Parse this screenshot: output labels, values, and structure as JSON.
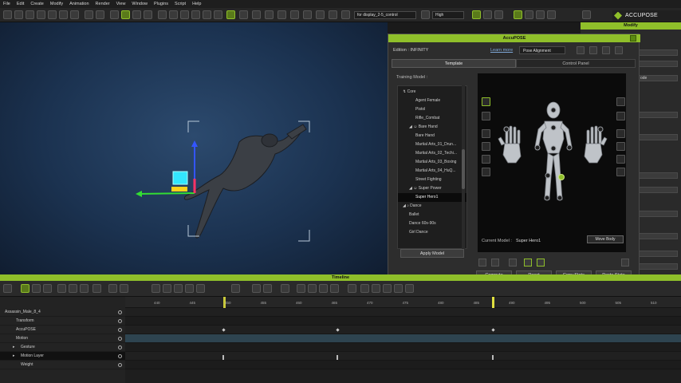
{
  "menu": [
    "File",
    "Edit",
    "Create",
    "Modify",
    "Animation",
    "Render",
    "View",
    "Window",
    "Plugins",
    "Script",
    "Help"
  ],
  "toolbar": {
    "display_select": "for display_2-5_control",
    "quality_select": "High",
    "brand": "ACCUPOSE"
  },
  "modify_panel": {
    "title": "Modify",
    "mode_text": "ode"
  },
  "accupose": {
    "title": "AccuPOSE",
    "edition_label": "Edition : INFINITY",
    "learn_more": "Learn more",
    "pose_alignment": "Pose Alignment",
    "tabs": [
      "Template",
      "Control Panel"
    ],
    "training_model_label": "Training Model :",
    "tree": [
      {
        "label": "Core",
        "indent": 0,
        "prefix": "↯"
      },
      {
        "label": "Agent Female",
        "indent": 2
      },
      {
        "label": "Pistol",
        "indent": 2
      },
      {
        "label": "Rifle_Combat",
        "indent": 2
      },
      {
        "label": "Bare Hand",
        "indent": 1,
        "prefix": "◢ ☺"
      },
      {
        "label": "Bare Hand",
        "indent": 2
      },
      {
        "label": "Martial Arts_01_Drun...",
        "indent": 2
      },
      {
        "label": "Martial Arts_02_Techi...",
        "indent": 2
      },
      {
        "label": "Martial Arts_03_Boxing",
        "indent": 2
      },
      {
        "label": "Martial Arts_04_HuQ...",
        "indent": 2
      },
      {
        "label": "Street Fighting",
        "indent": 2
      },
      {
        "label": "Super Power",
        "indent": 1,
        "prefix": "◢ ☺"
      },
      {
        "label": "Super Hero1",
        "indent": 2,
        "selected": true
      },
      {
        "label": "Dance",
        "indent": 0,
        "prefix": "◢ ♪"
      },
      {
        "label": "Ballet",
        "indent": 1
      },
      {
        "label": "Dance 60s-90s",
        "indent": 1
      },
      {
        "label": "Girl Dance",
        "indent": 1
      }
    ],
    "apply_model": "Apply Model",
    "current_model_label": "Current Model :",
    "current_model_value": "Super Hero1",
    "move_body": "Move Body",
    "buttons": [
      "Compute",
      "Reset",
      "Copy State",
      "Paste State"
    ]
  },
  "timeline": {
    "title": "Timeline",
    "tracks": [
      {
        "label": "Assassin_Male_8_4",
        "indent": 4,
        "arrow": "◢"
      },
      {
        "label": "Transform",
        "indent": 18
      },
      {
        "label": "AccuPOSE",
        "indent": 18
      },
      {
        "label": "Motion",
        "indent": 18
      },
      {
        "label": "Gesture",
        "indent": 24,
        "arrow": "▸"
      },
      {
        "label": "Motion Layer",
        "indent": 24,
        "arrow": "▸"
      },
      {
        "label": "Weight",
        "indent": 24
      }
    ],
    "ruler": [
      "440",
      "445",
      "450",
      "455",
      "460",
      "465",
      "470",
      "475",
      "480",
      "485",
      "490",
      "495",
      "500",
      "505",
      "510"
    ]
  },
  "colors": {
    "accent": "#8fbf2a",
    "viewport": "#1b3250",
    "panel": "#2d2d2d"
  }
}
